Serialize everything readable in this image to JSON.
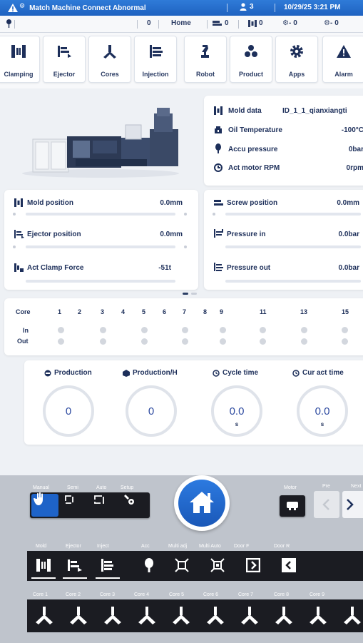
{
  "status": {
    "title": "Match Machine Connect Abnormal",
    "user_count": "3",
    "datetime": "10/29/25 3:21 PM"
  },
  "topbar": {
    "counter": "0",
    "home": "Home",
    "screw_count": "0",
    "mold_count": "0",
    "core_a_count": "0",
    "core_b_count": "0"
  },
  "nav": [
    "Clamping",
    "Ejector",
    "Cores",
    "Injection",
    "Robot",
    "Product",
    "Apps",
    "Alarm"
  ],
  "mold_info": {
    "mold_data_label": "Mold data",
    "mold_data_value": "ID_1_1_qianxiangti",
    "oil_temp_label": "Oil Temperature",
    "oil_temp_value": "-100°C",
    "accu_label": "Accu pressure",
    "accu_value": "0bar",
    "rpm_label": "Act motor RPM",
    "rpm_value": "0rpm"
  },
  "positions": {
    "mold_label": "Mold position",
    "mold_value": "0.0mm",
    "ejector_label": "Ejector position",
    "ejector_value": "0.0mm",
    "clamp_label": "Act Clamp Force",
    "clamp_value": "-51t",
    "screw_label": "Screw position",
    "screw_value": "0.0mm",
    "pin_label": "Pressure in",
    "pin_value": "0.0bar",
    "pout_label": "Pressure out",
    "pout_value": "0.0bar"
  },
  "cores": {
    "header": "Core",
    "numbers": [
      "1",
      "2",
      "3",
      "4",
      "5",
      "6",
      "7",
      "8",
      "9",
      "11",
      "13",
      "15"
    ],
    "in_label": "In",
    "out_label": "Out"
  },
  "stats": [
    {
      "title": "Production",
      "value": "0",
      "unit": ""
    },
    {
      "title": "Production/H",
      "value": "0",
      "unit": ""
    },
    {
      "title": "Cycle time",
      "value": "0.0",
      "unit": "s"
    },
    {
      "title": "Cur act time",
      "value": "0.0",
      "unit": "s"
    }
  ],
  "bottom": {
    "modes": [
      "Manual",
      "Semi",
      "Auto",
      "Setup"
    ],
    "motor_label": "Motor",
    "pre_label": "Pre",
    "next_label": "Next",
    "func_labels": [
      "Mold",
      "Ejector",
      "Inject",
      "Acc",
      "Multi adj",
      "Multi Auto",
      "Door F",
      "Door R"
    ],
    "core_labels": [
      "Core 1",
      "Core 2",
      "Core 3",
      "Core 4",
      "Core 5",
      "Core 6",
      "Core 7",
      "Core 8",
      "Core 9"
    ]
  },
  "colors": {
    "accent": "#1f62c0",
    "dark_button": "#1b1c22",
    "active_mode": "#1e63c8"
  }
}
